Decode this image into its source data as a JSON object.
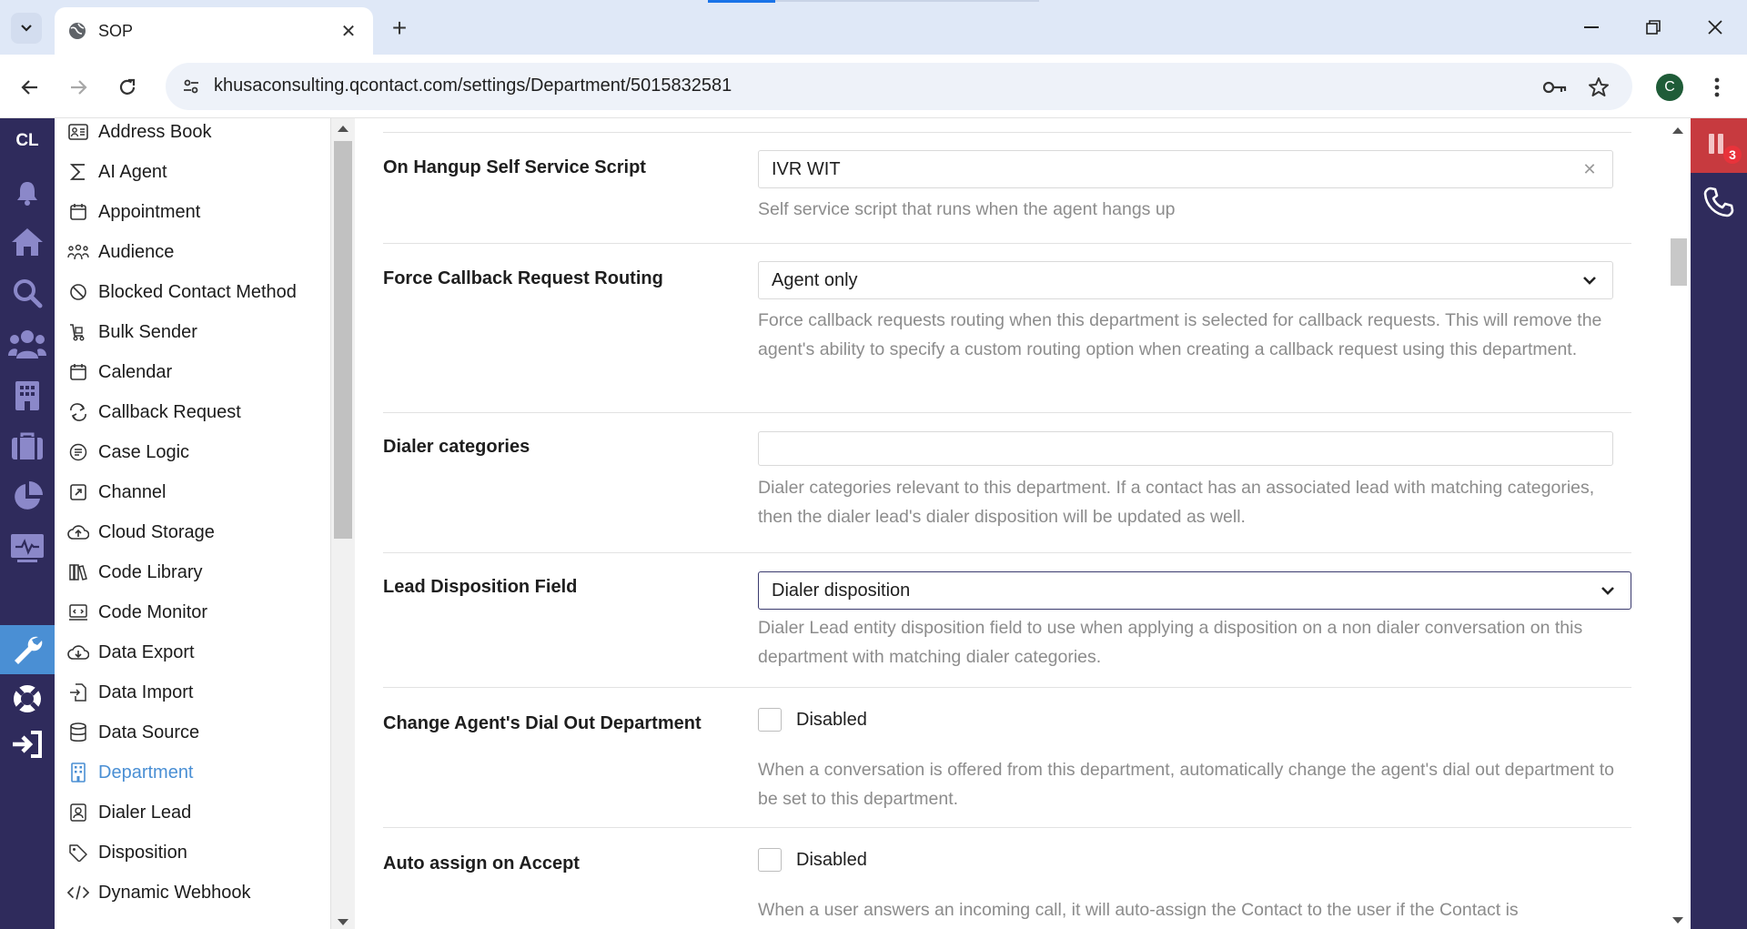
{
  "browser": {
    "tab_title": "SOP",
    "url": "khusaconsulting.qcontact.com/settings/Department/5015832581",
    "profile_initial": "C"
  },
  "rail": {
    "logo": "CL",
    "icons": [
      "bell-icon",
      "home-icon",
      "search-icon",
      "users-icon",
      "building-icon",
      "briefcase-icon",
      "pie-chart-icon",
      "monitor-icon",
      "wrench-icon",
      "lifebuoy-icon",
      "logout-icon"
    ],
    "active_color": "#4a8fd4"
  },
  "menu": {
    "items": [
      {
        "label": "Address Book",
        "icon": "address-book-icon"
      },
      {
        "label": "AI Agent",
        "icon": "sigma-icon"
      },
      {
        "label": "Appointment",
        "icon": "calendar-icon"
      },
      {
        "label": "Audience",
        "icon": "audience-icon"
      },
      {
        "label": "Blocked Contact Method",
        "icon": "blocked-icon"
      },
      {
        "label": "Bulk Sender",
        "icon": "bulk-sender-icon"
      },
      {
        "label": "Calendar",
        "icon": "calendar-icon"
      },
      {
        "label": "Callback Request",
        "icon": "callback-icon"
      },
      {
        "label": "Case Logic",
        "icon": "case-logic-icon"
      },
      {
        "label": "Channel",
        "icon": "channel-icon"
      },
      {
        "label": "Cloud Storage",
        "icon": "cloud-upload-icon"
      },
      {
        "label": "Code Library",
        "icon": "library-icon"
      },
      {
        "label": "Code Monitor",
        "icon": "code-monitor-icon"
      },
      {
        "label": "Data Export",
        "icon": "cloud-download-icon"
      },
      {
        "label": "Data Import",
        "icon": "file-import-icon"
      },
      {
        "label": "Data Source",
        "icon": "database-icon"
      },
      {
        "label": "Department",
        "icon": "department-icon",
        "active": true
      },
      {
        "label": "Dialer Lead",
        "icon": "dialer-lead-icon"
      },
      {
        "label": "Disposition",
        "icon": "tag-icon"
      },
      {
        "label": "Dynamic Webhook",
        "icon": "code-icon"
      }
    ]
  },
  "form": {
    "hangup_script": {
      "label": "On Hangup Self Service Script",
      "value": "IVR WIT",
      "help": "Self service script that runs when the agent hangs up"
    },
    "force_callback": {
      "label": "Force Callback Request Routing",
      "value": "Agent only",
      "help": "Force callback requests routing when this department is selected for callback requests. This will remove the agent's ability to specify a custom routing option when creating a callback request using this department."
    },
    "dialer_categories": {
      "label": "Dialer categories",
      "value": "",
      "help": "Dialer categories relevant to this department. If a contact has an associated lead with matching categories, then the dialer lead's dialer disposition will be updated as well."
    },
    "lead_disposition": {
      "label": "Lead Disposition Field",
      "value": "Dialer disposition",
      "help": "Dialer Lead entity disposition field to use when applying a disposition on a non dialer conversation on this department with matching dialer categories."
    },
    "change_dial_out": {
      "label": "Change Agent's Dial Out Department",
      "checkbox_label": "Disabled",
      "checked": false,
      "help": "When a conversation is offered from this department, automatically change the agent's dial out department to be set to this department."
    },
    "auto_assign": {
      "label": "Auto assign on Accept",
      "checkbox_label": "Disabled",
      "checked": false,
      "help": "When a user answers an incoming call, it will auto-assign the Contact to the user if the Contact is"
    }
  },
  "right_rail": {
    "badge": "3",
    "pause_color": "#c73a3f"
  }
}
